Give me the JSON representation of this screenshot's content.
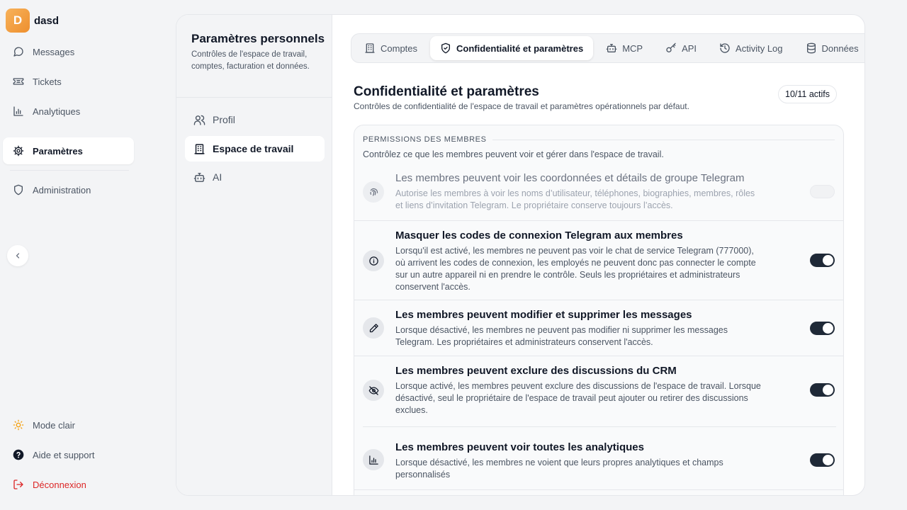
{
  "workspace": {
    "initial": "D",
    "name": "dasd"
  },
  "sidebar": {
    "items": [
      {
        "label": "Messages",
        "icon": "message-circle-icon"
      },
      {
        "label": "Tickets",
        "icon": "ticket-icon"
      },
      {
        "label": "Analytiques",
        "icon": "bar-chart-icon"
      },
      {
        "label": "Paramètres",
        "icon": "gear-icon",
        "active": true
      },
      {
        "label": "Administration",
        "icon": "shield-icon"
      }
    ],
    "bottom": [
      {
        "label": "Mode clair",
        "icon": "sun-icon"
      },
      {
        "label": "Aide et support",
        "icon": "help-circle-icon"
      },
      {
        "label": "Déconnexion",
        "icon": "logout-icon"
      }
    ]
  },
  "subnav": {
    "title": "Paramètres personnels",
    "description": "Contrôles de l'espace de travail, comptes, facturation et données.",
    "items": [
      {
        "label": "Profil",
        "icon": "users-icon"
      },
      {
        "label": "Espace de travail",
        "icon": "building-icon",
        "active": true
      },
      {
        "label": "AI",
        "icon": "bot-icon"
      }
    ]
  },
  "tabs": [
    {
      "label": "Comptes",
      "icon": "building-icon"
    },
    {
      "label": "Confidentialité et paramètres",
      "icon": "shield-check-icon",
      "active": true
    },
    {
      "label": "MCP",
      "icon": "bot-icon"
    },
    {
      "label": "API",
      "icon": "key-icon"
    },
    {
      "label": "Activity Log",
      "icon": "history-icon"
    },
    {
      "label": "Données",
      "icon": "database-icon"
    }
  ],
  "page": {
    "title": "Confidentialité et paramètres",
    "subtitle": "Contrôles de confidentialité de l'espace de travail et paramètres opérationnels par défaut.",
    "badge": "10/11 actifs"
  },
  "section": {
    "heading": "PERMISSIONS DES MEMBRES",
    "description": "Contrôlez ce que les membres peuvent voir et gérer dans l'espace de travail.",
    "rows": [
      {
        "title": "Les membres peuvent voir les coordonnées et détails de groupe Telegram",
        "description": "Autorise les membres à voir les noms d’utilisateur, téléphones, biographies, membres, rôles et liens d’invitation Telegram. Le propriétaire conserve toujours l’accès.",
        "icon": "fingerprint-icon",
        "enabled": false
      },
      {
        "title": "Masquer les codes de connexion Telegram aux membres",
        "description": "Lorsqu'il est activé, les membres ne peuvent pas voir le chat de service Telegram (777000), où arrivent les codes de connexion, les employés ne peuvent donc pas connecter le compte sur un autre appareil ni en prendre le contrôle. Seuls les propriétaires et administrateurs conservent l'accès.",
        "icon": "info-icon",
        "enabled": true
      },
      {
        "title": "Les membres peuvent modifier et supprimer les messages",
        "description": "Lorsque désactivé, les membres ne peuvent pas modifier ni supprimer les messages Telegram. Les propriétaires et administrateurs conservent l'accès.",
        "icon": "pencil-icon",
        "enabled": true
      },
      {
        "title": "Les membres peuvent exclure des discussions du CRM",
        "description": "Lorsque activé, les membres peuvent exclure des discussions de l'espace de travail. Lorsque désactivé, seul le propriétaire de l'espace de travail peut ajouter ou retirer des discussions exclues.",
        "icon": "eye-off-icon",
        "enabled": true
      },
      {
        "title": "Les membres peuvent voir toutes les analytiques",
        "description": "Lorsque désactivé, les membres ne voient que leurs propres analytiques et champs personnalisés",
        "icon": "bar-chart-icon",
        "enabled": true
      }
    ]
  },
  "colors": {
    "accent": "#1f2937",
    "logout": "#dc2626",
    "avatar": "#f0a04b",
    "sun": "#f59e0b"
  }
}
